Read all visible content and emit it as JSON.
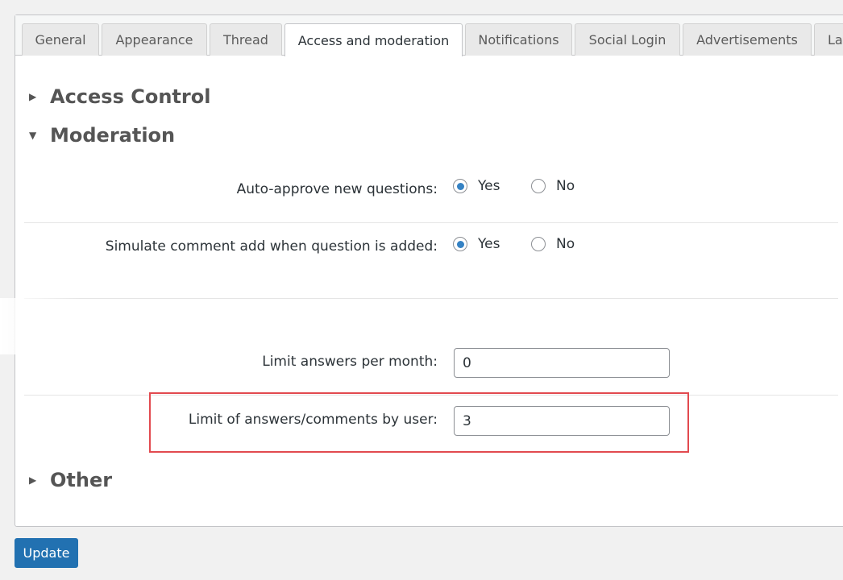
{
  "tabs": [
    {
      "label": "General"
    },
    {
      "label": "Appearance"
    },
    {
      "label": "Thread"
    },
    {
      "label": "Access and moderation"
    },
    {
      "label": "Notifications"
    },
    {
      "label": "Social Login"
    },
    {
      "label": "Advertisements"
    },
    {
      "label": "La"
    }
  ],
  "active_tab": "Access and moderation",
  "sections": {
    "access_control": {
      "title": "Access Control",
      "expanded": false
    },
    "moderation": {
      "title": "Moderation",
      "expanded": true
    },
    "other": {
      "title": "Other",
      "expanded": false
    }
  },
  "moderation": {
    "auto_approve": {
      "label": "Auto-approve new questions:",
      "yes": "Yes",
      "no": "No",
      "selected": "Yes"
    },
    "simulate_comment": {
      "label": "Simulate comment add when question is added:",
      "yes": "Yes",
      "no": "No",
      "selected": "Yes"
    },
    "limit_month": {
      "label": "Limit answers per month:",
      "value": "0"
    },
    "limit_user": {
      "label": "Limit of answers/comments by user:",
      "value": "3"
    }
  },
  "update_label": "Update",
  "colors": {
    "accent": "#2271b1",
    "highlight": "#e24a4f",
    "radio_dot": "#3582c4"
  }
}
